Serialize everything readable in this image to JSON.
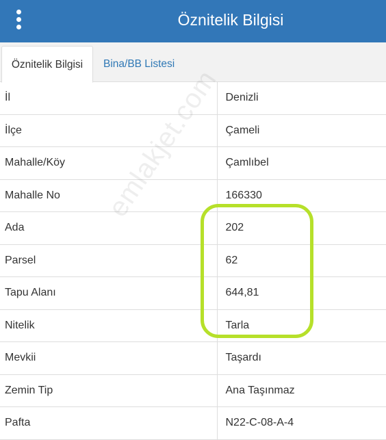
{
  "header": {
    "title": "Öznitelik Bilgisi"
  },
  "tabs": [
    {
      "label": "Öznitelik Bilgisi",
      "active": true
    },
    {
      "label": "Bina/BB Listesi",
      "active": false
    }
  ],
  "rows": [
    {
      "key": "İl",
      "value": "Denizli"
    },
    {
      "key": "İlçe",
      "value": "Çameli"
    },
    {
      "key": "Mahalle/Köy",
      "value": "Çamlıbel"
    },
    {
      "key": "Mahalle No",
      "value": "166330"
    },
    {
      "key": "Ada",
      "value": "202"
    },
    {
      "key": "Parsel",
      "value": "62"
    },
    {
      "key": "Tapu Alanı",
      "value": "644,81"
    },
    {
      "key": "Nitelik",
      "value": "Tarla"
    },
    {
      "key": "Mevkii",
      "value": "Taşardı"
    },
    {
      "key": "Zemin Tip",
      "value": "Ana Taşınmaz"
    },
    {
      "key": "Pafta",
      "value": "N22-C-08-A-4"
    }
  ],
  "watermark": "emlakjet.com",
  "colors": {
    "header_bg": "#3277b8",
    "tab_link": "#2f78b5",
    "highlight": "#b6e02a"
  },
  "icons": {
    "menu": "vertical-dots-icon"
  }
}
